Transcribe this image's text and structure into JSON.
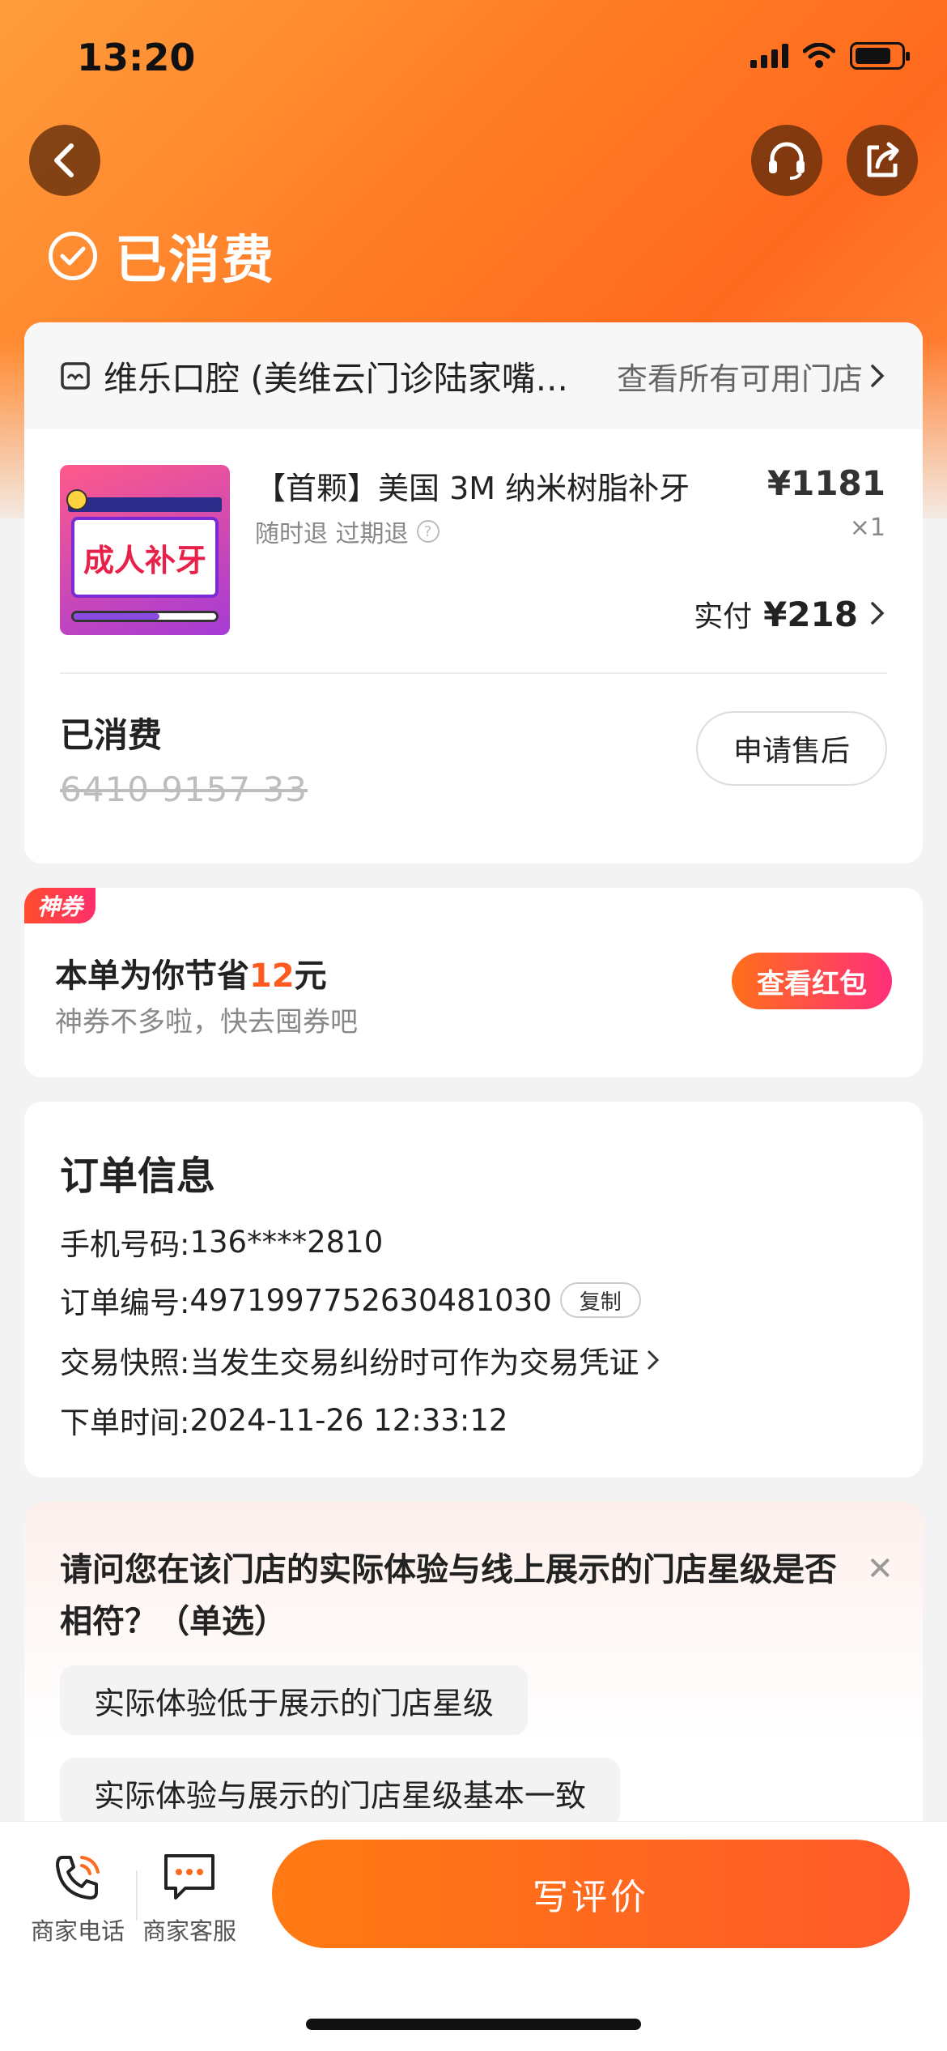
{
  "status_bar": {
    "time": "13:20"
  },
  "header": {
    "status_title": "已消费"
  },
  "store": {
    "name": "维乐口腔 (美维云门诊陆家嘴...",
    "all_stores_link": "查看所有可用门店"
  },
  "product": {
    "name": "【首颗】美国 3M 纳米树脂补牙",
    "refund_tags": "随时退 过期退",
    "thumb_text": "成人补牙",
    "price": "¥1181",
    "quantity": "×1",
    "paid_label": "实付",
    "paid_value": "¥218"
  },
  "voucher": {
    "status": "已消费",
    "code": "6410 9157 33",
    "after_sale_button": "申请售后"
  },
  "coupon": {
    "tag": "神券",
    "title_prefix": "本单为你节省",
    "saved_amount": "12",
    "title_suffix": "元",
    "subtitle": "神券不多啦，快去囤券吧",
    "button": "查看红包"
  },
  "order_info": {
    "title": "订单信息",
    "phone_label": "手机号码:",
    "phone_value": "136****2810",
    "order_no_label": "订单编号:",
    "order_no_value": "4971997752630481030",
    "copy_button": "复制",
    "snapshot_label": "交易快照:",
    "snapshot_value": "当发生交易纠纷时可作为交易凭证",
    "time_label": "下单时间:",
    "time_value": "2024-11-26 12:33:12"
  },
  "survey": {
    "question": "请问您在该门店的实际体验与线上展示的门店星级是否相符？（单选）",
    "options": [
      "实际体验低于展示的门店星级",
      "实际体验与展示的门店星级基本一致"
    ]
  },
  "bottom_bar": {
    "phone_label": "商家电话",
    "service_label": "商家客服",
    "review_button": "写评价"
  },
  "colors": {
    "brand_orange": "#ff6a1f",
    "highlight": "#ff5a1f",
    "coupon_pink": "#ff2f7a"
  }
}
